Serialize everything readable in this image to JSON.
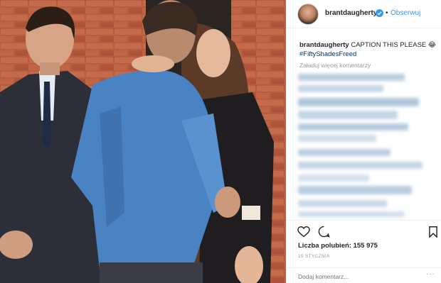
{
  "post": {
    "username": "brantdaugherty",
    "dot": "•",
    "follow_label": "Obserwuj",
    "caption_text": "CAPTION THIS PLEASE 😂",
    "hashtag": "#FiftyShadesFreed",
    "load_more": "Załaduj więcej komentarzy",
    "likes_text": "Liczba polubień: 155 975",
    "date": "19 STYCZNIA",
    "comment_placeholder": "Dodaj komentarz...",
    "more_glyph": "···"
  },
  "icons": {
    "verified": "verified-badge-icon",
    "like": "heart-icon",
    "comment": "comment-bubble-icon",
    "save": "bookmark-icon"
  },
  "colors": {
    "accent": "#3897f0",
    "hashtag": "#003569",
    "muted": "#999999",
    "divider": "#efefef"
  }
}
